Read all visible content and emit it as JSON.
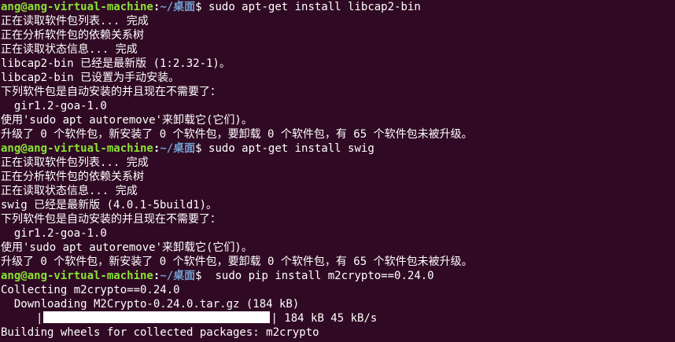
{
  "prompt": {
    "user_host": "ang@ang-virtual-machine",
    "colon": ":",
    "path": "~/桌面",
    "dollar": "$"
  },
  "blocks": [
    {
      "command": " sudo apt-get install libcap2-bin",
      "output": [
        "正在读取软件包列表... 完成",
        "正在分析软件包的依赖关系树",
        "正在读取状态信息... 完成",
        "libcap2-bin 已经是最新版 (1:2.32-1)。",
        "libcap2-bin 已设置为手动安装。",
        "下列软件包是自动安装的并且现在不需要了：",
        "  gir1.2-goa-1.0",
        "使用'sudo apt autoremove'来卸载它(它们)。",
        "升级了 0 个软件包，新安装了 0 个软件包，要卸载 0 个软件包，有 65 个软件包未被升级。"
      ]
    },
    {
      "command": " sudo apt-get install swig",
      "output": [
        "正在读取软件包列表... 完成",
        "正在分析软件包的依赖关系树",
        "正在读取状态信息... 完成",
        "swig 已经是最新版 (4.0.1-5build1)。",
        "下列软件包是自动安装的并且现在不需要了：",
        "  gir1.2-goa-1.0",
        "使用'sudo apt autoremove'来卸载它(它们)。",
        "升级了 0 个软件包，新安装了 0 个软件包，要卸载 0 个软件包，有 65 个软件包未被升级。"
      ]
    }
  ],
  "pip": {
    "command": "  sudo pip install m2crypto==0.24.0",
    "collecting": "Collecting m2crypto==0.24.0",
    "downloading": "  Downloading M2Crypto-0.24.0.tar.gz (184 kB)",
    "progress_fraction": 1.0,
    "progress_stats": " 184 kB 45 kB/s",
    "building": "Building wheels for collected packages: m2crypto"
  },
  "colors": {
    "background": "#300a24",
    "prompt_user": "#8ae234",
    "prompt_path": "#729fcf",
    "text": "#ffffff"
  }
}
